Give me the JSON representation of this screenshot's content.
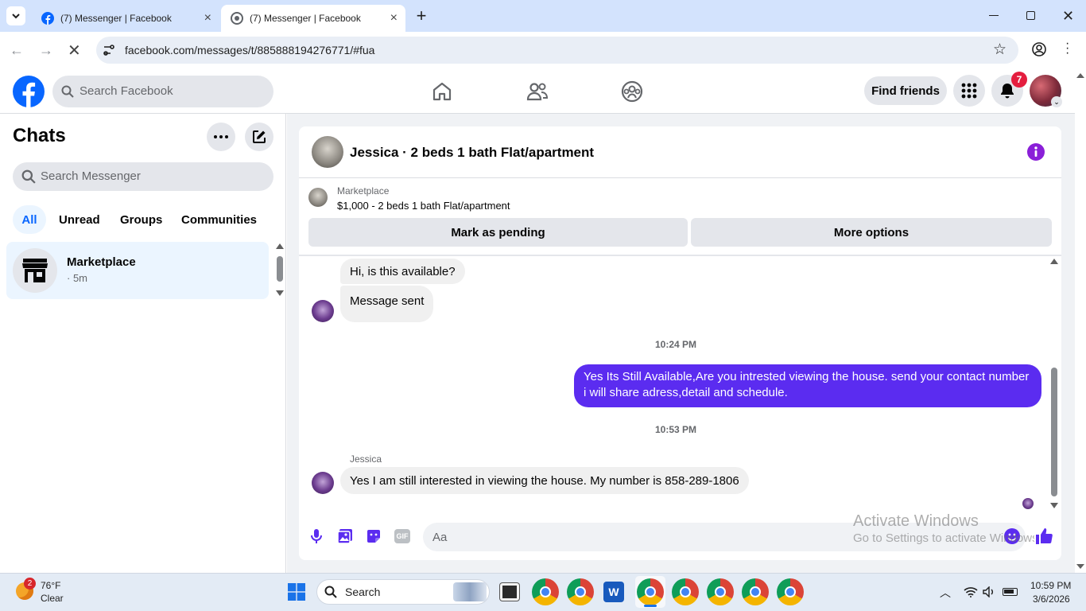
{
  "browser": {
    "tabs": [
      {
        "title": "(7) Messenger | Facebook",
        "active": false
      },
      {
        "title": "(7) Messenger | Facebook",
        "active": true
      }
    ],
    "url": "facebook.com/messages/t/885888194276771/#fua"
  },
  "header": {
    "search_placeholder": "Search Facebook",
    "find_friends_label": "Find friends",
    "notification_count": "7"
  },
  "sidebar": {
    "title": "Chats",
    "search_placeholder": "Search Messenger",
    "filters": [
      "All",
      "Unread",
      "Groups",
      "Communities"
    ],
    "chats": [
      {
        "name": "Marketplace",
        "meta": "· 5m"
      }
    ]
  },
  "chat": {
    "title": "Jessica · 2 beds 1 bath Flat/apartment",
    "listing": {
      "label": "Marketplace",
      "detail": "$1,000 - 2 beds 1 bath Flat/apartment"
    },
    "actions": {
      "mark_pending": "Mark as pending",
      "more_options": "More options"
    },
    "messages": [
      {
        "from": "them",
        "text": "Hi, is this available?"
      },
      {
        "from": "them",
        "text": "Message sent"
      },
      {
        "type": "time",
        "text": "10:24 PM"
      },
      {
        "from": "me",
        "text": "Yes Its Still Available,Are you intrested viewing the house. send your contact number i will share adress,detail and schedule."
      },
      {
        "type": "time",
        "text": "10:53 PM"
      },
      {
        "from": "them",
        "sender": "Jessica",
        "text": "Yes I am still interested in viewing the house. My number is 858-289-1806"
      }
    ],
    "composer_placeholder": "Aa"
  },
  "watermark": {
    "line1": "Activate Windows",
    "line2": "Go to Settings to activate Windows."
  },
  "taskbar": {
    "weather_temp": "76°F",
    "weather_cond": "Clear",
    "weather_badge": "2",
    "search_label": "Search",
    "time": "10:59 PM",
    "date": "3/6/2026"
  },
  "colors": {
    "fb_blue": "#0866ff",
    "outgoing_bubble": "#5b2cf0",
    "notification_red": "#e41e3f"
  }
}
